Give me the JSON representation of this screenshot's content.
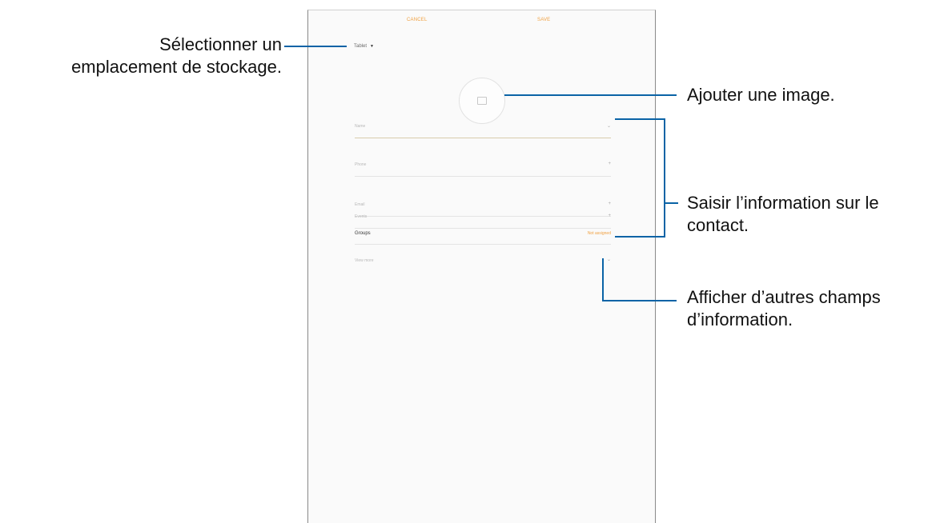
{
  "device": {
    "topbar": {
      "cancel_label": "CANCEL",
      "save_label": "SAVE"
    },
    "storage_selector": {
      "label": "Tablet",
      "caret": "▼"
    },
    "photo": {
      "icon": "camera-icon"
    },
    "fields": [
      {
        "placeholder": "Name",
        "action": "⌄"
      },
      {
        "placeholder": "Phone",
        "action": "+"
      },
      {
        "placeholder": "Email",
        "action": "+"
      },
      {
        "placeholder": "Events",
        "action": "+"
      }
    ],
    "group": {
      "label": "Groups",
      "value": "Not assigned"
    },
    "more": {
      "placeholder": "View more",
      "action": "⌄"
    }
  },
  "callouts": {
    "storage_line1": "Sélectionner un",
    "storage_line2": "emplacement de stockage.",
    "image": "Ajouter une image.",
    "info_line1": "Saisir l’information sur le",
    "info_line2": "contact.",
    "more_line1": "Afficher d’autres champs",
    "more_line2": "d’information."
  },
  "colors": {
    "accent": "#f0a040",
    "callout_line": "#0a63a6"
  }
}
